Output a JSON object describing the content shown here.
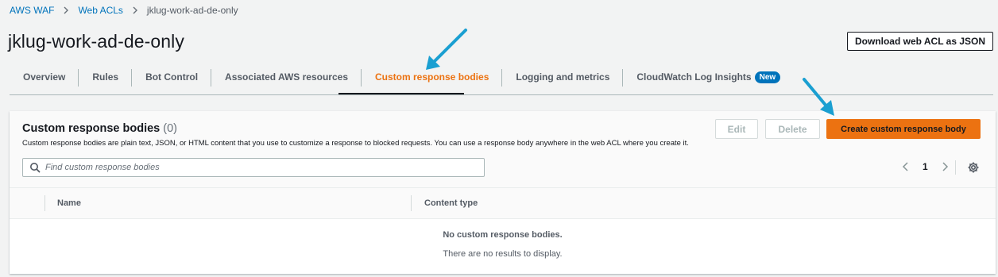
{
  "breadcrumb": {
    "items": [
      "AWS WAF",
      "Web ACLs",
      "jklug-work-ad-de-only"
    ]
  },
  "page": {
    "title": "jklug-work-ad-de-only",
    "download_label": "Download web ACL as JSON"
  },
  "tabs": [
    {
      "label": "Overview"
    },
    {
      "label": "Rules"
    },
    {
      "label": "Bot Control"
    },
    {
      "label": "Associated AWS resources"
    },
    {
      "label": "Custom response bodies",
      "active": true
    },
    {
      "label": "Logging and metrics"
    },
    {
      "label": "CloudWatch Log Insights",
      "badge": "New"
    }
  ],
  "panel": {
    "title": "Custom response bodies",
    "count": "(0)",
    "description": "Custom response bodies are plain text, JSON, or HTML content that you use to customize a response to blocked requests. You can use a response body anywhere in the web ACL where you create it.",
    "edit_label": "Edit",
    "delete_label": "Delete",
    "create_label": "Create custom response body",
    "search_placeholder": "Find custom response bodies",
    "search_value": "",
    "page_number": "1",
    "columns": [
      "Name",
      "Content type"
    ],
    "empty_title": "No custom response bodies.",
    "empty_subtitle": "There are no results to display."
  },
  "colors": {
    "accent": "#ec7211",
    "link": "#0073bb",
    "annotation_arrow": "#1a9fd1"
  },
  "icons": {
    "breadcrumb_separator": "chevron-right-icon",
    "search": "search-icon",
    "pager_prev": "chevron-left-icon",
    "pager_next": "chevron-right-icon",
    "settings": "gear-icon"
  }
}
